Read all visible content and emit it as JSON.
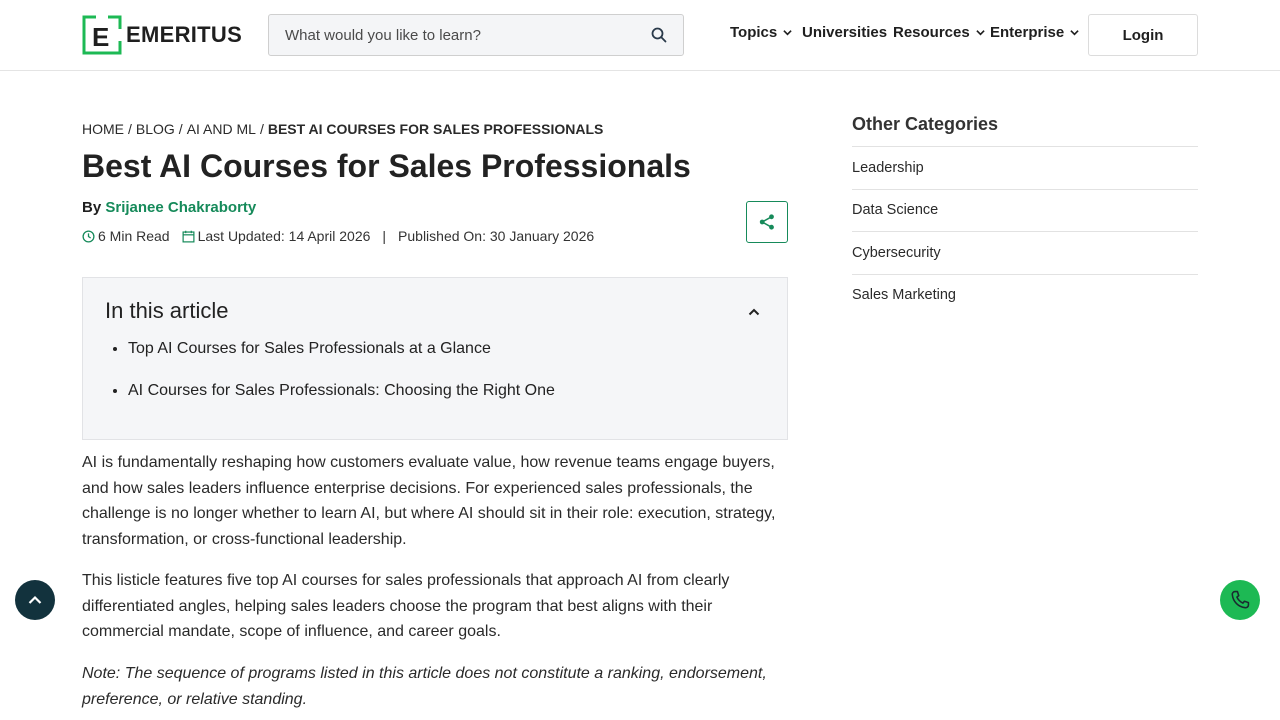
{
  "header": {
    "logo_text": "EMERITUS",
    "search_placeholder": "What would you like to learn?",
    "nav": [
      {
        "label": "Topics",
        "has_dropdown": true
      },
      {
        "label": "Universities",
        "has_dropdown": false
      },
      {
        "label": "Resources",
        "has_dropdown": true
      },
      {
        "label": "Enterprise",
        "has_dropdown": true
      }
    ],
    "login_label": "Login",
    "brand_color": "#168a5a"
  },
  "breadcrumb": {
    "items": [
      "HOME",
      "BLOG",
      "AI AND ML"
    ],
    "current": "BEST AI COURSES FOR SALES PROFESSIONALS"
  },
  "article": {
    "title": "Best AI Courses for Sales Professionals",
    "by_label": "By",
    "author": "Srijanee Chakraborty",
    "read_time": "6 Min Read",
    "last_updated": "Last Updated: 14 April 2026",
    "separator": "|",
    "published": "Published On: 30 January 2026",
    "toc": {
      "title": "In this article",
      "items": [
        "Top AI Courses for Sales Professionals at a Glance",
        "AI Courses for Sales Professionals: Choosing the Right One"
      ]
    },
    "paragraphs": [
      "AI is fundamentally reshaping how customers evaluate value, how revenue teams engage buyers, and how sales leaders influence enterprise decisions. For experienced sales professionals, the challenge is no longer whether to learn AI, but where AI should sit in their role: execution, strategy, transformation, or cross-functional leadership.",
      "This listicle features five top AI courses for sales professionals that approach AI from clearly differentiated angles, helping sales leaders choose the program that best aligns with their commercial mandate, scope of influence, and career goals.",
      "Note: The sequence of programs listed in this article does not constitute a ranking, endorsement, preference, or relative standing."
    ]
  },
  "sidebar": {
    "title": "Other Categories",
    "items": [
      "Leadership",
      "Data Science",
      "Cybersecurity",
      "Sales Marketing"
    ]
  },
  "icons": {
    "search": "search-icon",
    "clock": "clock-icon",
    "calendar": "calendar-icon",
    "share": "share-icon",
    "scroll_up": "chevron-up-icon",
    "phone": "phone-icon"
  }
}
